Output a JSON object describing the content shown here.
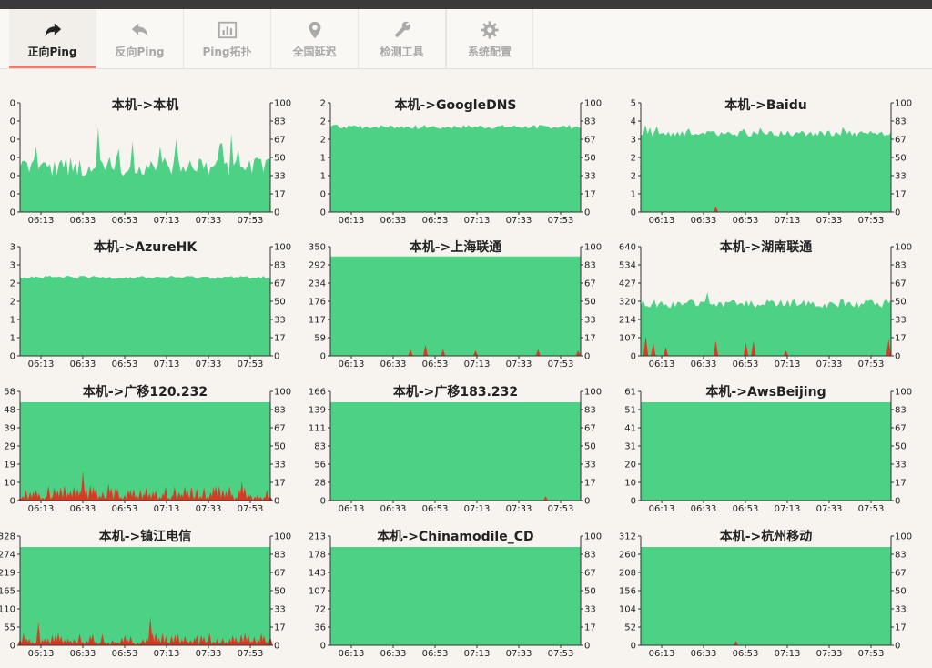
{
  "colors": {
    "latency": "#4cd185",
    "loss": "#d93a23",
    "active_tab_indicator": "#f07b72"
  },
  "tabs": [
    {
      "label": "正向Ping",
      "icon": "forward-arrow-icon",
      "active": true
    },
    {
      "label": "反向Ping",
      "icon": "reply-arrow-icon",
      "active": false
    },
    {
      "label": "Ping拓扑",
      "icon": "bar-chart-icon",
      "active": false
    },
    {
      "label": "全国延迟",
      "icon": "map-pin-icon",
      "active": false
    },
    {
      "label": "检测工具",
      "icon": "wrench-icon",
      "active": false
    },
    {
      "label": "系统配置",
      "icon": "gear-icon",
      "active": false
    }
  ],
  "chart_data": [
    {
      "type": "area",
      "title": "本机->本机",
      "x_ticks": [
        "06:13",
        "06:33",
        "06:53",
        "07:13",
        "07:33",
        "07:53"
      ],
      "y_left_ticks": [
        "0",
        "0",
        "0",
        "0",
        "0",
        "0",
        "0"
      ],
      "y_right_ticks": [
        "0",
        "17",
        "33",
        "50",
        "67",
        "83",
        "100"
      ],
      "latency_level": 0.42,
      "latency_jitter": 0.18,
      "loss_spikes": []
    },
    {
      "type": "area",
      "title": "本机->GoogleDNS",
      "x_ticks": [
        "06:13",
        "06:33",
        "06:53",
        "07:13",
        "07:33",
        "07:53"
      ],
      "y_left_ticks": [
        "0",
        "0",
        "1",
        "1",
        "2",
        "2",
        "2"
      ],
      "y_right_ticks": [
        "0",
        "17",
        "33",
        "50",
        "67",
        "83",
        "100"
      ],
      "latency_level": 0.78,
      "latency_jitter": 0.04,
      "loss_spikes": []
    },
    {
      "type": "area",
      "title": "本机->Baidu",
      "x_ticks": [
        "06:13",
        "06:33",
        "06:53",
        "07:13",
        "07:33",
        "07:53"
      ],
      "y_left_ticks": [
        "0",
        "1",
        "2",
        "2",
        "3",
        "4",
        "5"
      ],
      "y_right_ticks": [
        "0",
        "17",
        "33",
        "50",
        "67",
        "83",
        "100"
      ],
      "latency_level": 0.72,
      "latency_jitter": 0.06,
      "loss_spikes": [
        [
          0.3,
          0.05
        ]
      ]
    },
    {
      "type": "area",
      "title": "本机->AzureHK",
      "x_ticks": [
        "06:13",
        "06:33",
        "06:53",
        "07:13",
        "07:33",
        "07:53"
      ],
      "y_left_ticks": [
        "0",
        "1",
        "1",
        "2",
        "2",
        "3",
        "3"
      ],
      "y_right_ticks": [
        "0",
        "17",
        "33",
        "50",
        "67",
        "83",
        "100"
      ],
      "latency_level": 0.72,
      "latency_jitter": 0.03,
      "loss_spikes": []
    },
    {
      "type": "area",
      "title": "本机->上海联通",
      "x_ticks": [
        "06:13",
        "06:33",
        "06:53",
        "07:13",
        "07:33",
        "07:53"
      ],
      "y_left_ticks": [
        "0",
        "59",
        "117",
        "176",
        "234",
        "292",
        "350"
      ],
      "y_right_ticks": [
        "0",
        "17",
        "33",
        "50",
        "67",
        "83",
        "100"
      ],
      "latency_level": 0.91,
      "latency_jitter": 0.0,
      "loss_spikes": [
        [
          0.32,
          0.06
        ],
        [
          0.38,
          0.1
        ],
        [
          0.45,
          0.06
        ],
        [
          0.58,
          0.05
        ],
        [
          0.83,
          0.06
        ],
        [
          0.99,
          0.05
        ]
      ]
    },
    {
      "type": "area",
      "title": "本机->湖南联通",
      "x_ticks": [
        "06:13",
        "06:33",
        "06:53",
        "07:13",
        "07:33",
        "07:53"
      ],
      "y_left_ticks": [
        "0",
        "107",
        "214",
        "320",
        "427",
        "534",
        "640"
      ],
      "y_right_ticks": [
        "0",
        "17",
        "33",
        "50",
        "67",
        "83",
        "100"
      ],
      "latency_level": 0.48,
      "latency_jitter": 0.08,
      "loss_spikes": [
        [
          0.02,
          0.18
        ],
        [
          0.05,
          0.12
        ],
        [
          0.1,
          0.08
        ],
        [
          0.3,
          0.14
        ],
        [
          0.42,
          0.12
        ],
        [
          0.45,
          0.14
        ],
        [
          0.58,
          0.05
        ],
        [
          0.99,
          0.15
        ]
      ]
    },
    {
      "type": "area",
      "title": "本机->广移120.232",
      "x_ticks": [
        "06:13",
        "06:33",
        "06:53",
        "07:13",
        "07:33",
        "07:53"
      ],
      "y_left_ticks": [
        "0",
        "10",
        "19",
        "29",
        "39",
        "48",
        "58"
      ],
      "y_right_ticks": [
        "0",
        "17",
        "33",
        "50",
        "67",
        "83",
        "100"
      ],
      "latency_level": 0.9,
      "latency_jitter": 0.0,
      "loss_spikes": "dense-medium"
    },
    {
      "type": "area",
      "title": "本机->广移183.232",
      "x_ticks": [
        "06:13",
        "06:33",
        "06:53",
        "07:13",
        "07:33",
        "07:53"
      ],
      "y_left_ticks": [
        "0",
        "28",
        "56",
        "83",
        "111",
        "139",
        "166"
      ],
      "y_right_ticks": [
        "0",
        "17",
        "33",
        "50",
        "67",
        "83",
        "100"
      ],
      "latency_level": 0.9,
      "latency_jitter": 0.0,
      "loss_spikes": [
        [
          0.86,
          0.04
        ]
      ]
    },
    {
      "type": "area",
      "title": "本机->AwsBeijing",
      "x_ticks": [
        "06:13",
        "06:33",
        "06:53",
        "07:13",
        "07:33",
        "07:53"
      ],
      "y_left_ticks": [
        "0",
        "10",
        "20",
        "31",
        "41",
        "51",
        "61"
      ],
      "y_right_ticks": [
        "0",
        "17",
        "33",
        "50",
        "67",
        "83",
        "100"
      ],
      "latency_level": 0.9,
      "latency_jitter": 0.0,
      "loss_spikes": []
    },
    {
      "type": "area",
      "title": "本机->镇江电信",
      "x_ticks": [
        "06:13",
        "06:33",
        "06:53",
        "07:13",
        "07:33",
        "07:53"
      ],
      "y_left_ticks": [
        "0",
        "55",
        "110",
        "165",
        "219",
        "274",
        "328"
      ],
      "y_right_ticks": [
        "0",
        "17",
        "33",
        "50",
        "67",
        "83",
        "100"
      ],
      "latency_level": 0.9,
      "latency_jitter": 0.0,
      "loss_spikes": "dense-low"
    },
    {
      "type": "area",
      "title": "本机->Chinamodile_CD",
      "x_ticks": [
        "06:13",
        "06:33",
        "06:53",
        "07:13",
        "07:33",
        "07:53"
      ],
      "y_left_ticks": [
        "0",
        "36",
        "72",
        "107",
        "143",
        "178",
        "213"
      ],
      "y_right_ticks": [
        "0",
        "17",
        "33",
        "50",
        "67",
        "83",
        "100"
      ],
      "latency_level": 0.9,
      "latency_jitter": 0.0,
      "loss_spikes": []
    },
    {
      "type": "area",
      "title": "本机->杭州移动",
      "x_ticks": [
        "06:13",
        "06:33",
        "06:53",
        "07:13",
        "07:33",
        "07:53"
      ],
      "y_left_ticks": [
        "0",
        "52",
        "104",
        "156",
        "208",
        "260",
        "312"
      ],
      "y_right_ticks": [
        "0",
        "17",
        "33",
        "50",
        "67",
        "83",
        "100"
      ],
      "latency_level": 0.9,
      "latency_jitter": 0.0,
      "loss_spikes": [
        [
          0.38,
          0.04
        ]
      ]
    }
  ]
}
